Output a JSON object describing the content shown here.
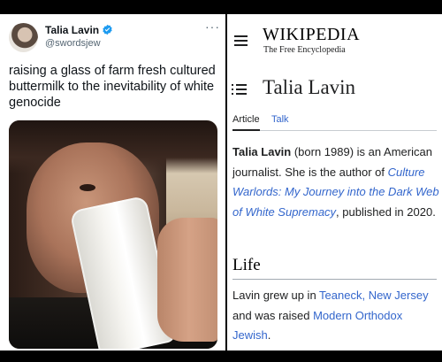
{
  "tweet": {
    "author_name": "Talia Lavin",
    "handle": "@swordsjew",
    "more_label": "···",
    "text": "raising a glass of farm fresh cultured buttermilk to the inevitability of white genocide",
    "verified_color": "#1d9bf0",
    "icons": {
      "more": "more-options-icon",
      "verified": "verified-badge-icon"
    }
  },
  "wiki": {
    "wordmark": "WIKIPEDIA",
    "tagline": "The Free Encyclopedia",
    "page_title": "Talia Lavin",
    "tabs": [
      {
        "label": "Article"
      },
      {
        "label": "Talk"
      }
    ],
    "lead": {
      "subject": "Talia Lavin",
      "born": " (born 1989) is an American journalist. She is the author of ",
      "book_title": "Culture Warlords: My Journey into the Dark Web of White Supremacy",
      "after_book": ", published in 2020."
    },
    "section": {
      "heading": "Life",
      "text_a": "Lavin grew up in ",
      "link_a": "Teaneck, New Jersey",
      "text_b": " and was raised ",
      "link_b": "Modern Orthodox Jewish",
      "text_c": "."
    },
    "link_color": "#3366cc",
    "icons": {
      "menu": "hamburger-menu-icon",
      "toc": "table-of-contents-icon"
    }
  }
}
